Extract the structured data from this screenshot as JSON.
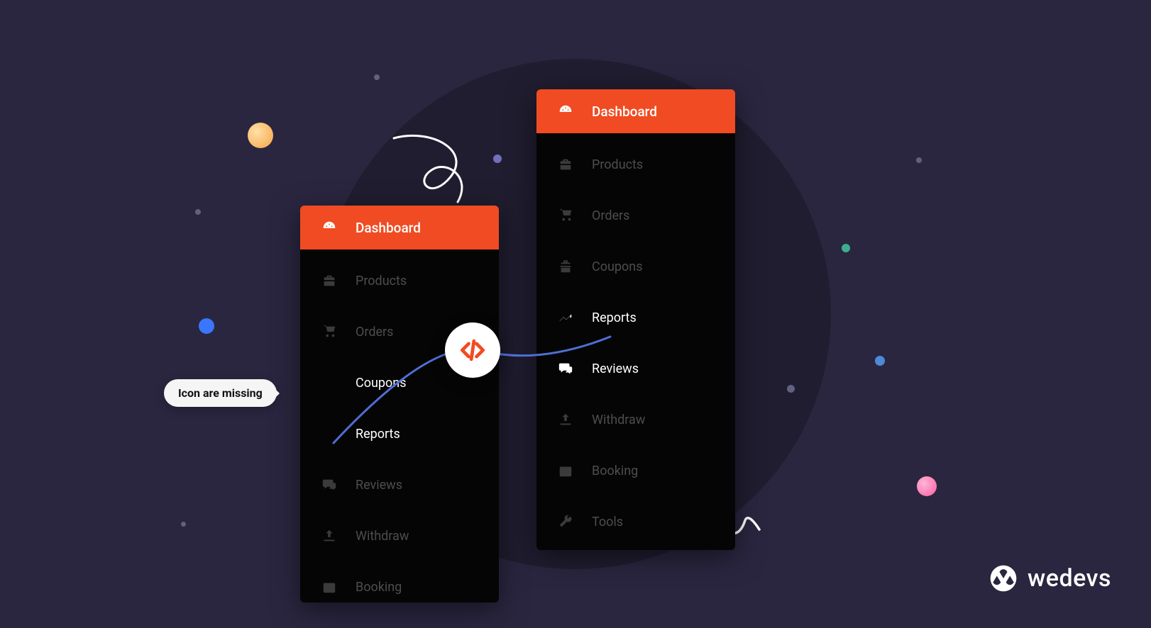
{
  "tooltip": {
    "text": "Icon are missing"
  },
  "panel_left": {
    "header": {
      "label": "Dashboard",
      "icon": "dashboard-icon"
    },
    "items": [
      {
        "label": "Products",
        "icon": "briefcase-icon",
        "has_icon": true,
        "active": false
      },
      {
        "label": "Orders",
        "icon": "cart-icon",
        "has_icon": true,
        "active": false
      },
      {
        "label": "Coupons",
        "icon": null,
        "has_icon": false,
        "active": true
      },
      {
        "label": "Reports",
        "icon": null,
        "has_icon": false,
        "active": true
      },
      {
        "label": "Reviews",
        "icon": "reviews-icon",
        "has_icon": true,
        "active": false
      },
      {
        "label": "Withdraw",
        "icon": "upload-icon",
        "has_icon": true,
        "active": false
      },
      {
        "label": "Booking",
        "icon": "calendar-icon",
        "has_icon": true,
        "active": false
      }
    ]
  },
  "panel_right": {
    "header": {
      "label": "Dashboard",
      "icon": "dashboard-icon"
    },
    "items": [
      {
        "label": "Products",
        "icon": "briefcase-icon",
        "has_icon": true,
        "active": false
      },
      {
        "label": "Orders",
        "icon": "cart-icon",
        "has_icon": true,
        "active": false
      },
      {
        "label": "Coupons",
        "icon": "gift-icon",
        "has_icon": true,
        "active": false
      },
      {
        "label": "Reports",
        "icon": "trend-icon",
        "has_icon": true,
        "active": true
      },
      {
        "label": "Reviews",
        "icon": "reviews-icon",
        "has_icon": true,
        "active": true
      },
      {
        "label": "Withdraw",
        "icon": "upload-icon",
        "has_icon": true,
        "active": false
      },
      {
        "label": "Booking",
        "icon": "calendar-icon",
        "has_icon": true,
        "active": false
      },
      {
        "label": "Tools",
        "icon": "wrench-icon",
        "has_icon": true,
        "active": false
      }
    ]
  },
  "brand": {
    "name": "wedevs"
  },
  "colors": {
    "bg": "#2a2640",
    "accent": "#f04b22",
    "panel": "#050505",
    "muted": "#4d4d4d"
  }
}
